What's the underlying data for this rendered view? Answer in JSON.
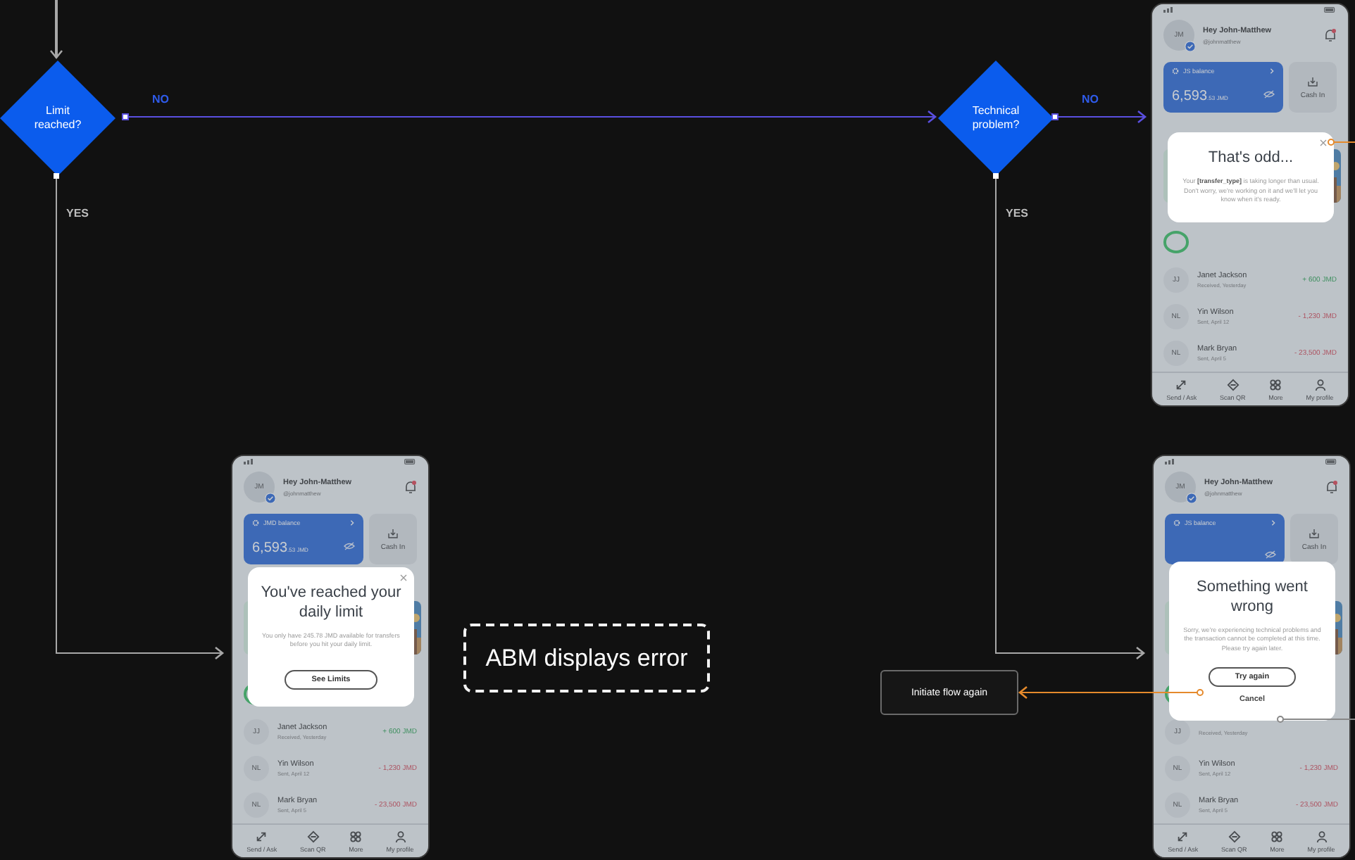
{
  "decisions": [
    {
      "label": "Limit reached?"
    },
    {
      "label": "Technical problem?"
    }
  ],
  "branch_labels": [
    {
      "text": "NO",
      "kind": "no"
    },
    {
      "text": "YES",
      "kind": "yes"
    },
    {
      "text": "NO",
      "kind": "no"
    },
    {
      "text": "YES",
      "kind": "yes"
    }
  ],
  "nodes": [
    {
      "kind": "annotation",
      "label": "ABM displays error"
    },
    {
      "kind": "process",
      "label": "Initiate flow again"
    }
  ],
  "screens": [
    {
      "avatar": "JM",
      "greeting": "Hey John-Matthew",
      "handle": "@johnmatthew",
      "balance_label": "JS balance",
      "balance_amount": "6,593",
      "balance_decimals": ".53 JMD",
      "cash_in": "Cash In",
      "transactions": [
        {
          "initials": "JJ",
          "name": "Janet Jackson",
          "detail": "Received, Yesterday",
          "amount": "+ 600 JMD",
          "kind": "credit"
        },
        {
          "initials": "NL",
          "name": "Yin Wilson",
          "detail": "Sent, April 12",
          "amount": "- 1,230 JMD",
          "kind": "debit"
        },
        {
          "initials": "NL",
          "name": "Mark Bryan",
          "detail": "Sent, April 5",
          "amount": "- 23,500 JMD",
          "kind": "debit"
        }
      ],
      "nav": [
        "Send / Ask",
        "Scan QR",
        "More",
        "My profile"
      ],
      "dialog": {
        "has_close": true,
        "title": "That's odd...",
        "body": [
          "Your **[transfer_type]** is taking longer than usual.",
          "Don't worry, we're working on it and we'll let you know when it's ready."
        ]
      }
    },
    {
      "avatar": "JM",
      "greeting": "Hey John-Matthew",
      "handle": "@johnmatthew",
      "balance_label": "JMD balance",
      "balance_amount": "6,593",
      "balance_decimals": ".53 JMD",
      "cash_in": "Cash In",
      "transactions": [
        {
          "initials": "JJ",
          "name": "Janet Jackson",
          "detail": "Received, Yesterday",
          "amount": "+ 600 JMD",
          "kind": "credit"
        },
        {
          "initials": "NL",
          "name": "Yin Wilson",
          "detail": "Sent, April 12",
          "amount": "- 1,230 JMD",
          "kind": "debit"
        },
        {
          "initials": "NL",
          "name": "Mark Bryan",
          "detail": "Sent, April 5",
          "amount": "- 23,500 JMD",
          "kind": "debit"
        }
      ],
      "nav": [
        "Send / Ask",
        "Scan QR",
        "More",
        "My profile"
      ],
      "dialog": {
        "has_close": true,
        "title": "You've reached your daily limit",
        "body": [
          "You only have 245.78 JMD available for transfers before you hit your daily limit."
        ],
        "primary_button": "See Limits"
      }
    },
    {
      "avatar": "JM",
      "greeting": "Hey John-Matthew",
      "handle": "@johnmatthew",
      "balance_label": "JS balance",
      "cash_in": "Cash In",
      "transactions": [
        {
          "initials": "JJ",
          "detail": "Received, Yesterday"
        },
        {
          "initials": "NL",
          "name": "Yin Wilson",
          "detail": "Sent, April 12",
          "amount": "- 1,230 JMD",
          "kind": "debit"
        },
        {
          "initials": "NL",
          "name": "Mark Bryan",
          "detail": "Sent, April 5",
          "amount": "- 23,500 JMD",
          "kind": "debit"
        }
      ],
      "nav": [
        "Send / Ask",
        "Scan QR",
        "More",
        "My profile"
      ],
      "dialog": {
        "has_close": false,
        "title": "Something went wrong",
        "body": [
          "Sorry, we're experiencing technical problems and the transaction cannot be completed at this time. Please try again later."
        ],
        "primary_button": "Try again",
        "link": "Cancel"
      }
    }
  ]
}
